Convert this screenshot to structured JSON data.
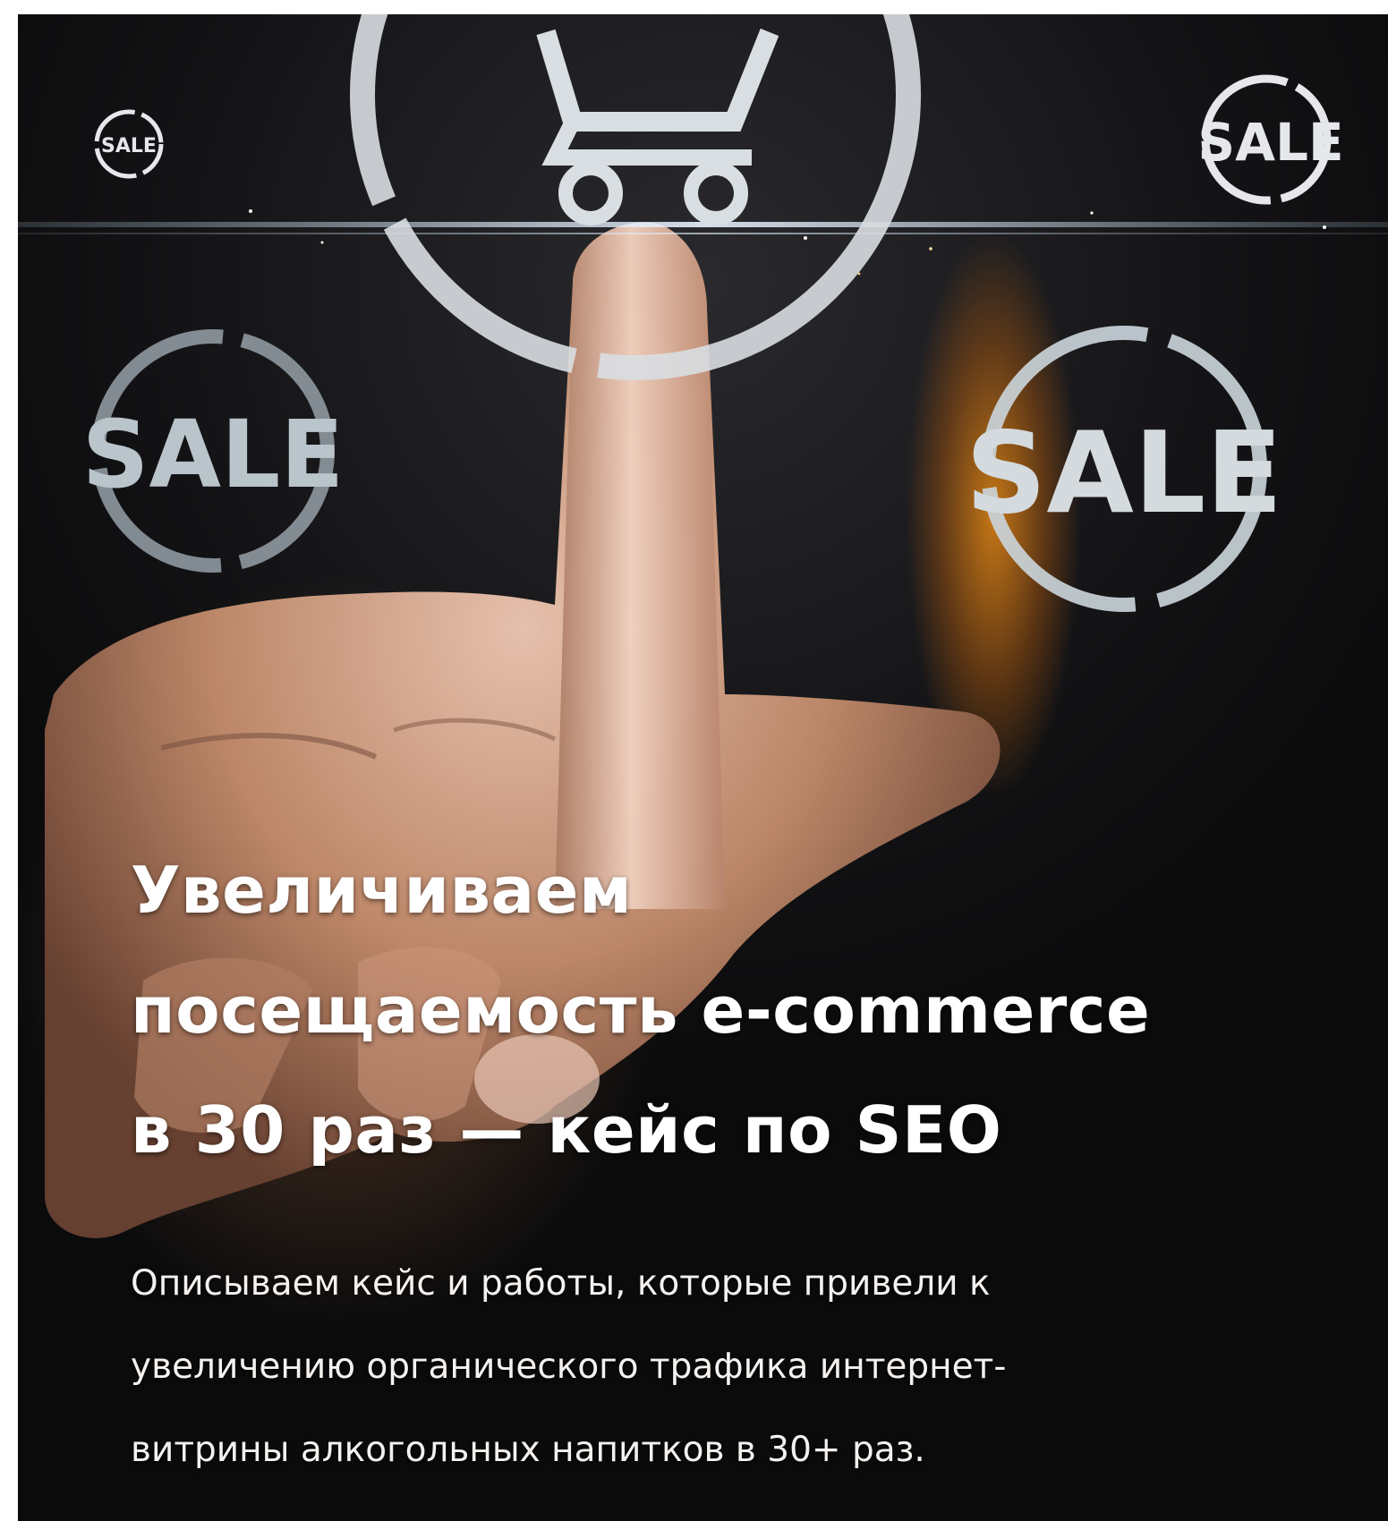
{
  "article": {
    "headline_lines": [
      "Увеличиваем",
      "посещаемость e-commerce",
      "в 30 раз — кейс по SEO"
    ],
    "lead_lines": [
      "Описываем кейс и работы, которые привели к",
      "увеличению органического трафика интернет-",
      "витрины алкогольных напитков в 30+ раз."
    ]
  },
  "image": {
    "badge_text": "SALE",
    "icons": [
      "sale-badge-icon",
      "shopping-cart-icon"
    ]
  },
  "colors": {
    "background": "#121214",
    "text": "#ffffff",
    "glow": "#ff9a1a",
    "ring": "#c9d3d8"
  }
}
